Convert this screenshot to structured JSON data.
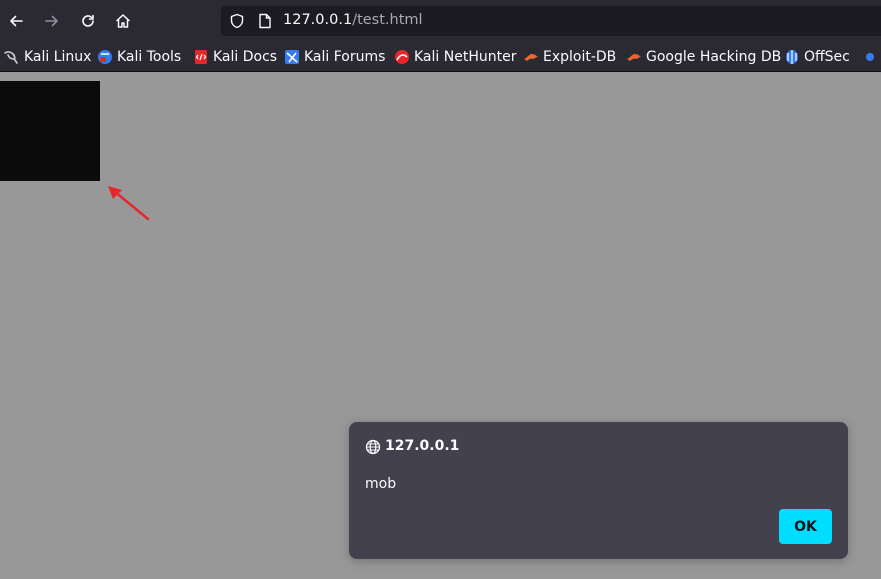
{
  "browser": {
    "url_host": "127.0.0.1",
    "url_path": "/test.html"
  },
  "bookmarks": [
    {
      "label": "Kali Linux",
      "icon": "kali-dragon-icon"
    },
    {
      "label": "Kali Tools",
      "icon": "kali-tools-icon"
    },
    {
      "label": "Kali Docs",
      "icon": "kali-docs-icon"
    },
    {
      "label": "Kali Forums",
      "icon": "kali-forums-icon"
    },
    {
      "label": "Kali NetHunter",
      "icon": "kali-nethunter-icon"
    },
    {
      "label": "Exploit-DB",
      "icon": "exploit-db-icon"
    },
    {
      "label": "Google Hacking DB",
      "icon": "ghdb-icon"
    },
    {
      "label": "OffSec",
      "icon": "offsec-icon"
    }
  ],
  "dialog": {
    "origin": "127.0.0.1",
    "message": "mob",
    "ok_label": "OK"
  },
  "colors": {
    "page_background": "#999899",
    "toolbar": "#2b2a33",
    "dialog_background": "#42414d",
    "ok_button": "#00ddff",
    "arrow": "#e8262a"
  }
}
